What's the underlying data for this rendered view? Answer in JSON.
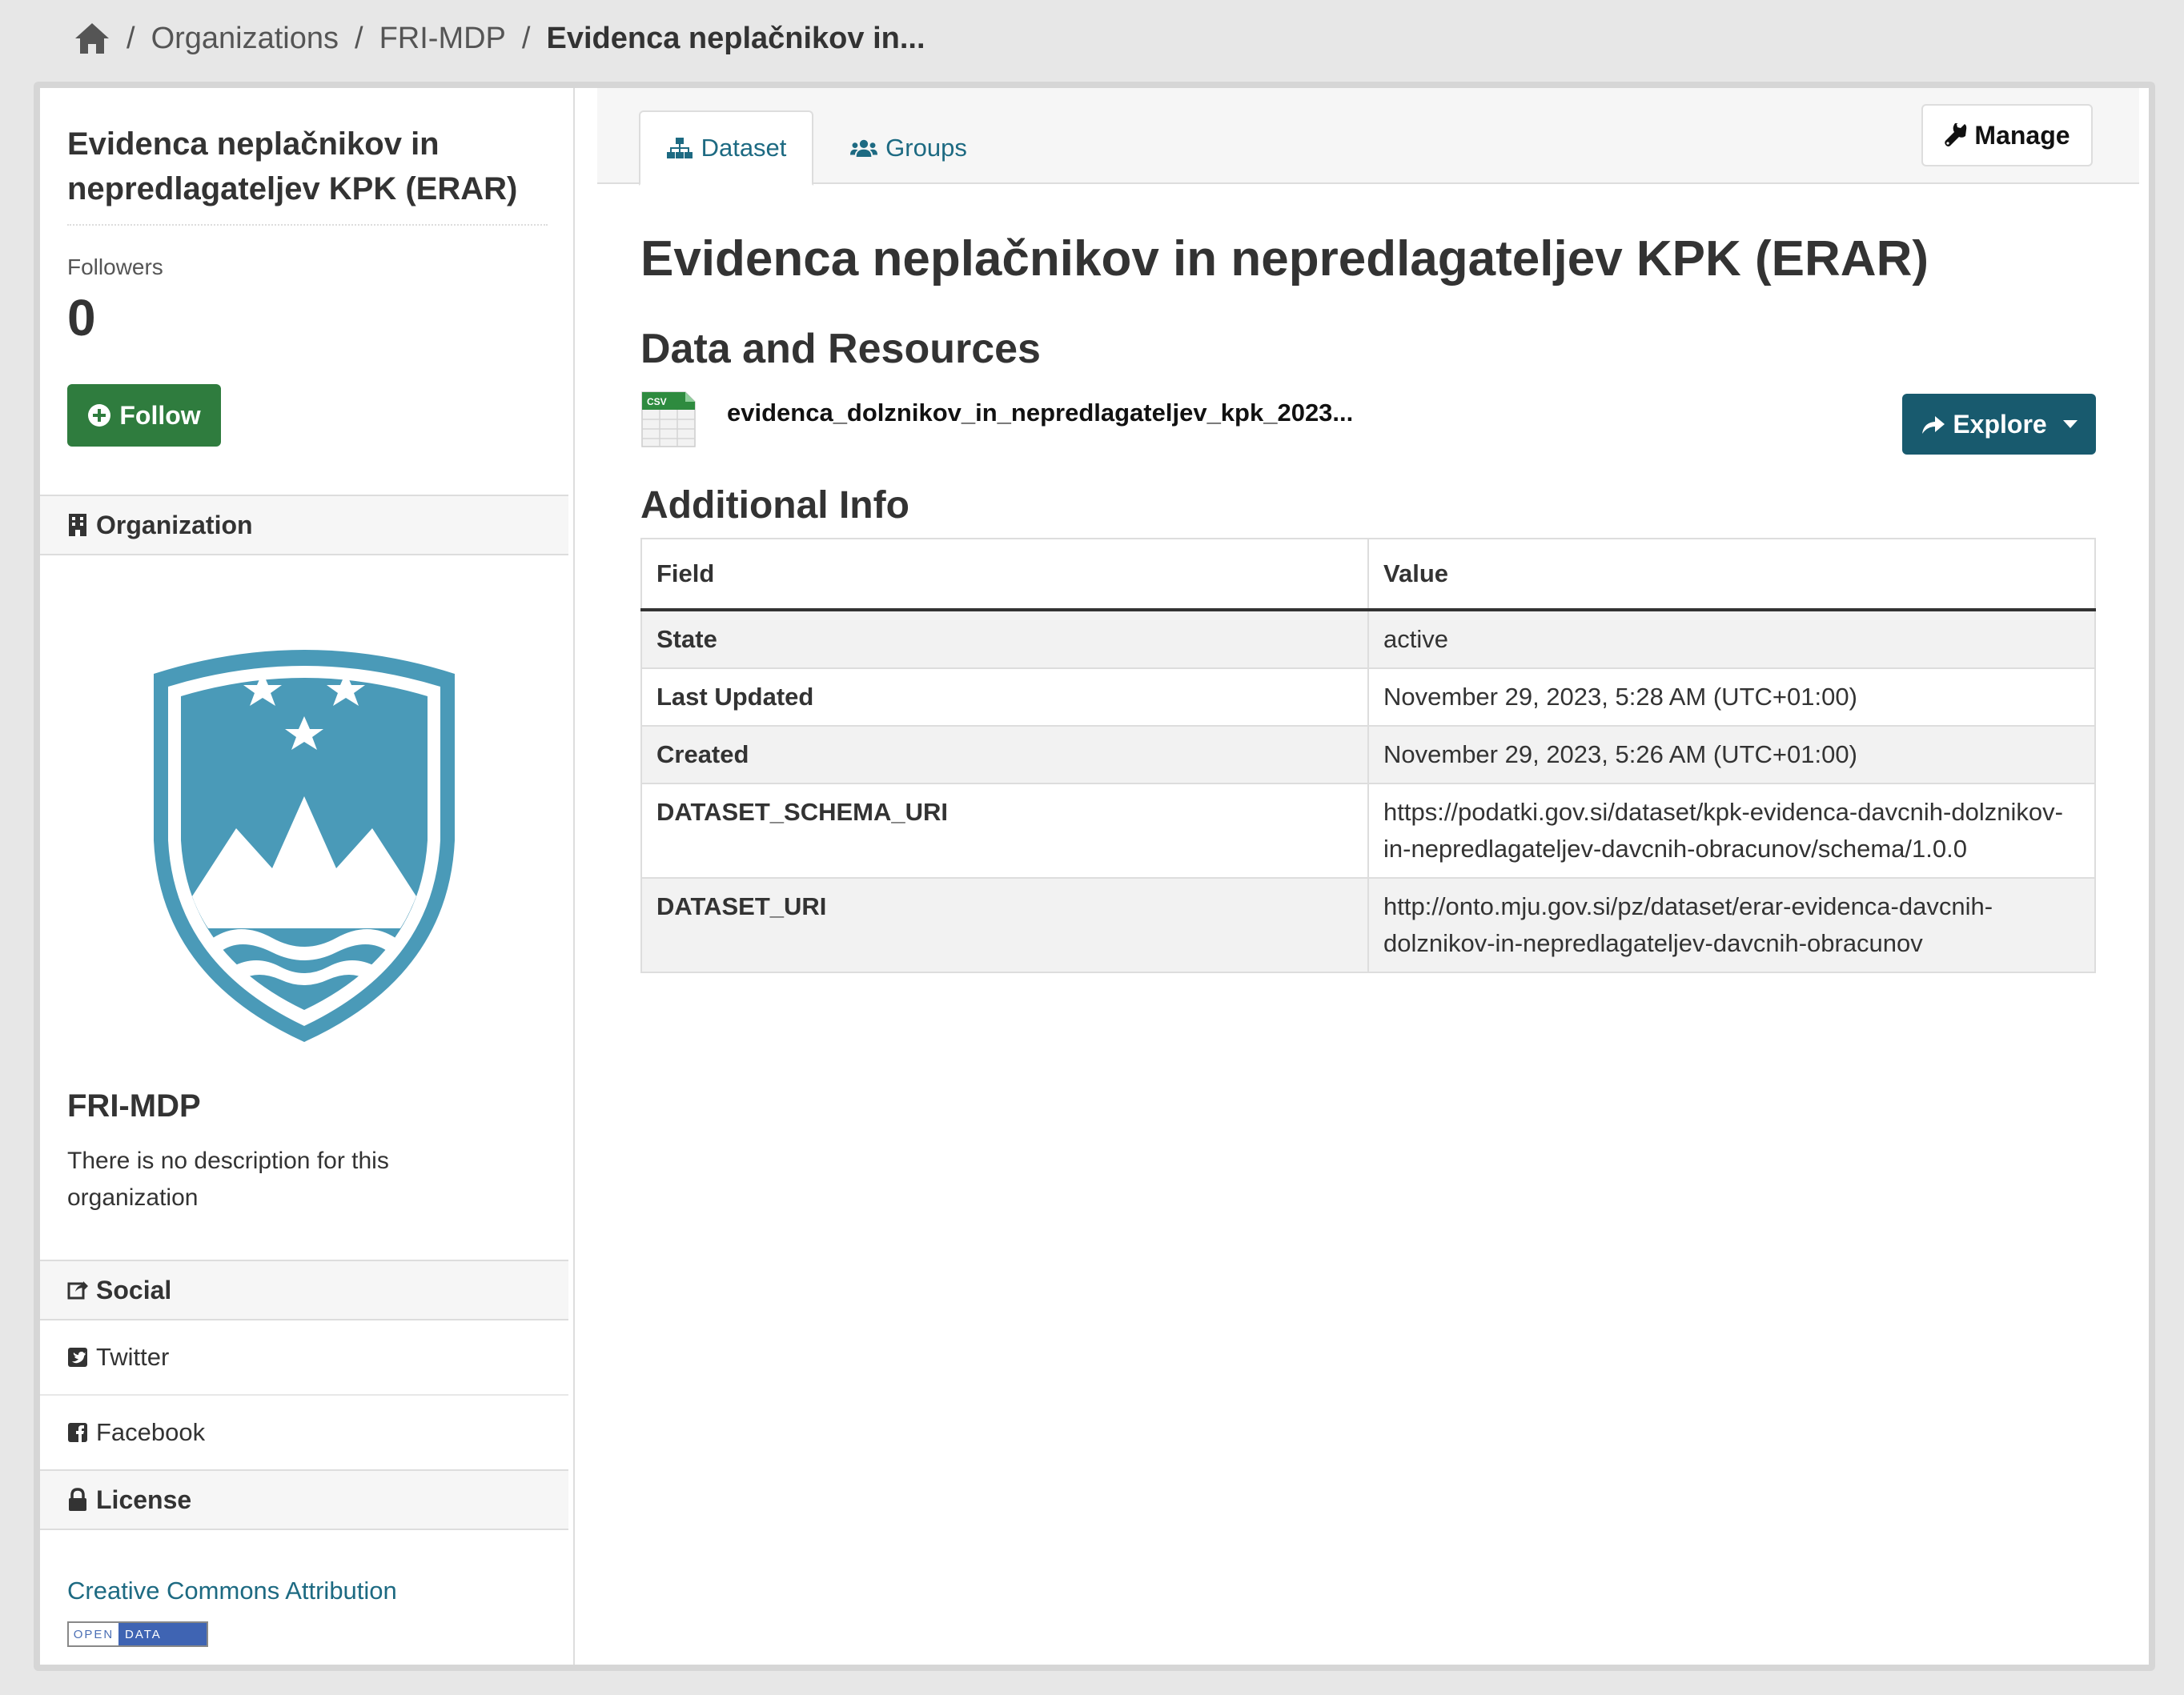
{
  "breadcrumb": {
    "home_icon": "home-icon",
    "items": [
      "Organizations",
      "FRI-MDP",
      "Evidenca neplačnikov in..."
    ]
  },
  "sidebar": {
    "title": "Evidenca neplačnikov in nepredlagateljev KPK (ERAR)",
    "followers_label": "Followers",
    "followers_count": "0",
    "follow_label": "Follow",
    "organization_heading": "Organization",
    "org_name": "FRI-MDP",
    "org_description": "There is no description for this organization",
    "social_heading": "Social",
    "social_items": [
      "Twitter",
      "Facebook"
    ],
    "license_heading": "License",
    "license_link": "Creative Commons Attribution",
    "opendata_badge": [
      "OPEN",
      "DATA"
    ]
  },
  "tabs": [
    {
      "label": "Dataset",
      "icon": "sitemap-icon",
      "active": true
    },
    {
      "label": "Groups",
      "icon": "users-icon",
      "active": false
    }
  ],
  "manage_label": "Manage",
  "main": {
    "title": "Evidenca neplačnikov in nepredlagateljev KPK (ERAR)",
    "resources_heading": "Data and Resources",
    "resource": {
      "format": "CSV",
      "name": "evidenca_dolznikov_in_nepredlagateljev_kpk_2023...",
      "explore_label": "Explore"
    },
    "additional_heading": "Additional Info",
    "table": {
      "headers": [
        "Field",
        "Value"
      ],
      "rows": [
        {
          "field": "State",
          "value": "active"
        },
        {
          "field": "Last Updated",
          "value": "November 29, 2023, 5:28 AM (UTC+01:00)"
        },
        {
          "field": "Created",
          "value": "November 29, 2023, 5:26 AM (UTC+01:00)"
        },
        {
          "field": "DATASET_SCHEMA_URI",
          "value": "https://podatki.gov.si/dataset/kpk-evidenca-davcnih-dolznikov-in-nepredlagateljev-davcnih-obracunov/schema/1.0.0"
        },
        {
          "field": "DATASET_URI",
          "value": "http://onto.mju.gov.si/pz/dataset/erar-evidenca-davcnih-dolznikov-in-nepredlagateljev-davcnih-obracunov"
        }
      ]
    }
  },
  "colors": {
    "follow_green": "#2f7c3e",
    "explore_teal": "#185a6e",
    "link_blue": "#1d6a82",
    "crest_blue": "#4a9ab8"
  }
}
